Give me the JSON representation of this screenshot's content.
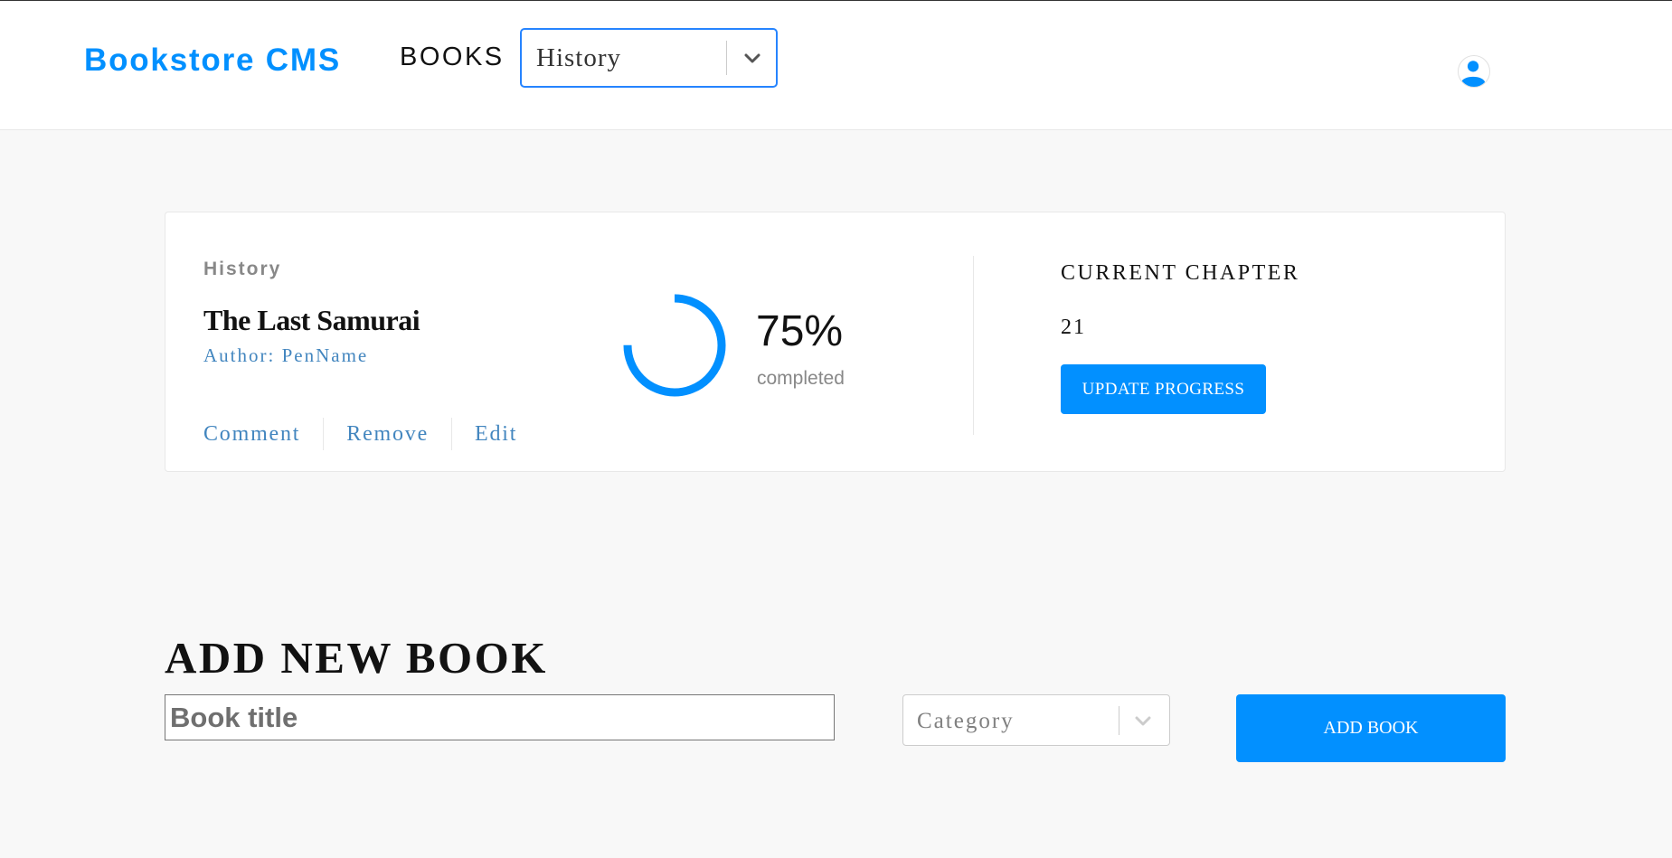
{
  "header": {
    "logo": "Bookstore CMS",
    "nav_books": "BOOKS",
    "filter": {
      "selected": "History"
    },
    "user_icon": "user-circle-icon"
  },
  "book": {
    "category": "History",
    "title": "The Last Samurai",
    "author": "Author: PenName",
    "actions": [
      "Comment",
      "Remove",
      "Edit"
    ],
    "progress": {
      "percent_label": "75%",
      "fraction": 0.75,
      "completed_label": "completed"
    },
    "current_chapter_label": "CURRENT CHAPTER",
    "current_chapter": "21",
    "update_button": "UPDATE PROGRESS"
  },
  "add_book": {
    "heading": "ADD NEW BOOK",
    "title_placeholder": "Book title",
    "category_placeholder": "Category",
    "submit_button": "ADD BOOK"
  },
  "colors": {
    "accent": "#0290ff",
    "link": "#4386bf",
    "ring_track": "#e8e8e8",
    "background": "#f8f8f8"
  }
}
